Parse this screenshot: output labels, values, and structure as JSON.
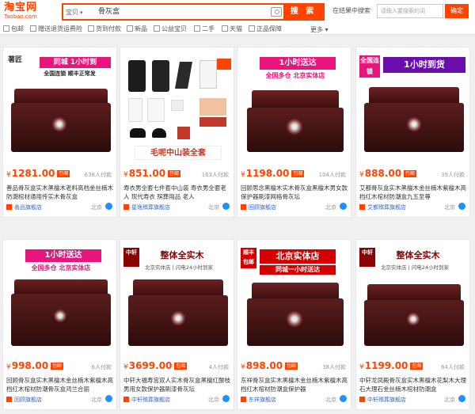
{
  "header": {
    "logo_cn": "淘宝网",
    "logo_en": "Taobao.com",
    "category": "宝贝",
    "query": "骨灰盒",
    "search_label": "搜 索",
    "in_results_label": "在结果中搜索",
    "in_results_placeholder": "请输入要搜索的词",
    "confirm_label": "确定"
  },
  "filters": {
    "items": [
      "包邮",
      "赠送退货运费险",
      "货到付款",
      "新品",
      "公益宝贝",
      "二手",
      "天猫",
      "正品保障"
    ],
    "more_label": "更多"
  },
  "products": [
    {
      "price": "1281.00",
      "paid": "638人付款",
      "title": "善品骨灰盒实木黑檀木老料高档金丝楠木防潮棺材通用传实木骨灰盒",
      "shop": "善品旗舰店",
      "loc": "北京",
      "banner": "同城 1小时到",
      "sub": "全国连锁 顺丰正常发",
      "corner": "著匠"
    },
    {
      "price": "851.00",
      "paid": "163人付款",
      "title": "寿衣男全套七件套中山装 寿衣男全套老人 现代寿衣 殡葬用品 老人",
      "shop": "星逸殡葬旗舰店",
      "loc": "北京",
      "banner": "毛呢中山装全套",
      "sub": "",
      "corner": ""
    },
    {
      "price": "1198.00",
      "paid": "104人付款",
      "title": "回顾思念黑檀木实木骨灰盒黑檀木男女款保护器刷漆网格骨灰坛",
      "shop": "回顾旗舰店",
      "loc": "北京",
      "banner": "1小时送达",
      "sub": "全国多仓 北京实体店",
      "corner": ""
    },
    {
      "price": "888.00",
      "paid": "39人付款",
      "title": "艾都骨灰盒实木黑檀木金丝楠木紫檀木高档红木棺材防潮盒九五至尊",
      "shop": "艾都殡葬旗舰店",
      "loc": "北京",
      "banner": "1小时到货",
      "sub": "全国连锁",
      "corner": ""
    },
    {
      "price": "998.00",
      "paid": "6人付款",
      "title": "回顾骨灰盒实木黑檀木金丝楠木紫檀木高档红木棺材防潮骨灰盒鸿兰合丽",
      "shop": "回顾旗舰店",
      "loc": "北京",
      "banner": "1小时送达",
      "sub": "全国多仓 北京实体店",
      "corner": ""
    },
    {
      "price": "3699.00",
      "paid": "4人付款",
      "title": "中轩大福寿宫双人实木骨灰盒黑檀红酸枝男用女款保护器刷漆骨灰坛",
      "shop": "中轩殡葬旗舰店",
      "loc": "北京",
      "banner": "整体全实木",
      "sub": "北京实体店 | 闪电24小时到家",
      "corner": "中轩"
    },
    {
      "price": "898.00",
      "paid": "38人付款",
      "title": "东祥骨灰盒实木黑檀木金丝楠木紫檀木高档红木棺材防潮盒保护器",
      "shop": "东祥旗舰店",
      "loc": "北京",
      "banner": "北京实体店",
      "sub": "同城一小时送达",
      "corner": "顺丰包邮"
    },
    {
      "price": "1199.00",
      "paid": "64人付款",
      "title": "中轩龙凤殿骨灰盒实木黑檀木花梨木大理石大理石金丝楠木棺材防潮盒",
      "shop": "中轩殡葬旗舰店",
      "loc": "北京",
      "banner": "整体全实木",
      "sub": "北京实体店 | 闪电24小时到家",
      "corner": "中轩"
    }
  ]
}
